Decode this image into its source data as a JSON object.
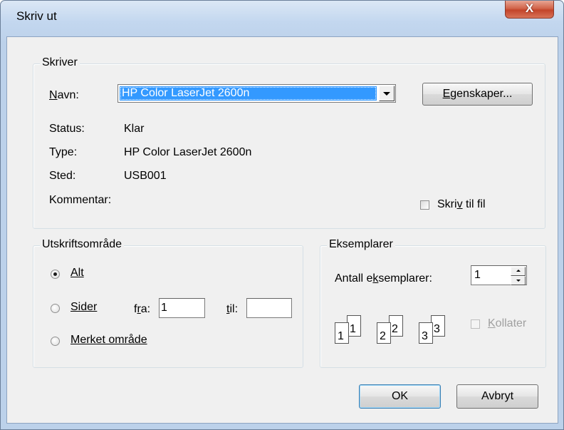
{
  "window": {
    "title": "Skriv ut",
    "close_glyph": "X"
  },
  "printer_group": {
    "legend": "Skriver",
    "name_label": "Navn:",
    "name_label_accel": "N",
    "name_label_rest": "avn:",
    "selected_printer": "HP Color LaserJet 2600n",
    "properties_button_accel": "E",
    "properties_button_rest": "genskaper...",
    "status_label": "Status:",
    "status_value": "Klar",
    "type_label": "Type:",
    "type_value": "HP Color LaserJet 2600n",
    "location_label": "Sted:",
    "location_value": "USB001",
    "comment_label": "Kommentar:",
    "print_to_file_pre": "Skri",
    "print_to_file_accel": "v",
    "print_to_file_post": " til fil",
    "print_to_file_checked": false
  },
  "range_group": {
    "legend": "Utskriftsområde",
    "all_label": "Alt",
    "pages_label": "Sider",
    "from_label_pre": "f",
    "from_label_accel": "r",
    "from_label_post": "a:",
    "from_value": "1",
    "to_label_accel": "t",
    "to_label_rest": "il:",
    "to_value": "",
    "selection_label": "Merket område",
    "selected": "all"
  },
  "copies_group": {
    "legend": "Eksemplarer",
    "count_label_pre": "Antall e",
    "count_label_accel": "k",
    "count_label_post": "semplarer:",
    "count_value": "1",
    "collate_label_accel": "K",
    "collate_label_rest": "ollater",
    "collate_checked": false,
    "collate_enabled": false,
    "icon_pages": [
      "1",
      "1",
      "2",
      "2",
      "3",
      "3"
    ]
  },
  "buttons": {
    "ok": "OK",
    "cancel": "Avbryt"
  }
}
